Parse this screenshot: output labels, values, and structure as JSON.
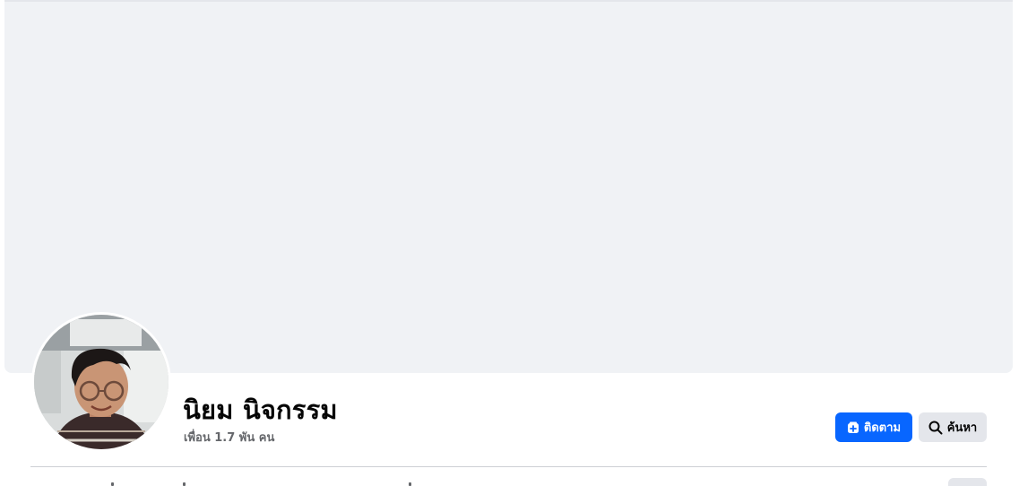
{
  "profile": {
    "name": "นิยม นิจกรรม",
    "friends": "เพื่อน 1.7 พัน คน"
  },
  "actions": {
    "follow_label": "ติดตาม",
    "search_label": "ค้นหา"
  },
  "icons": {
    "follow": "follow-plus-icon",
    "search": "search-icon"
  },
  "colors": {
    "primary": "#0866ff",
    "secondary_button": "#e4e6eb",
    "cover_placeholder": "#f0f2f5",
    "muted_text": "#65676b"
  }
}
